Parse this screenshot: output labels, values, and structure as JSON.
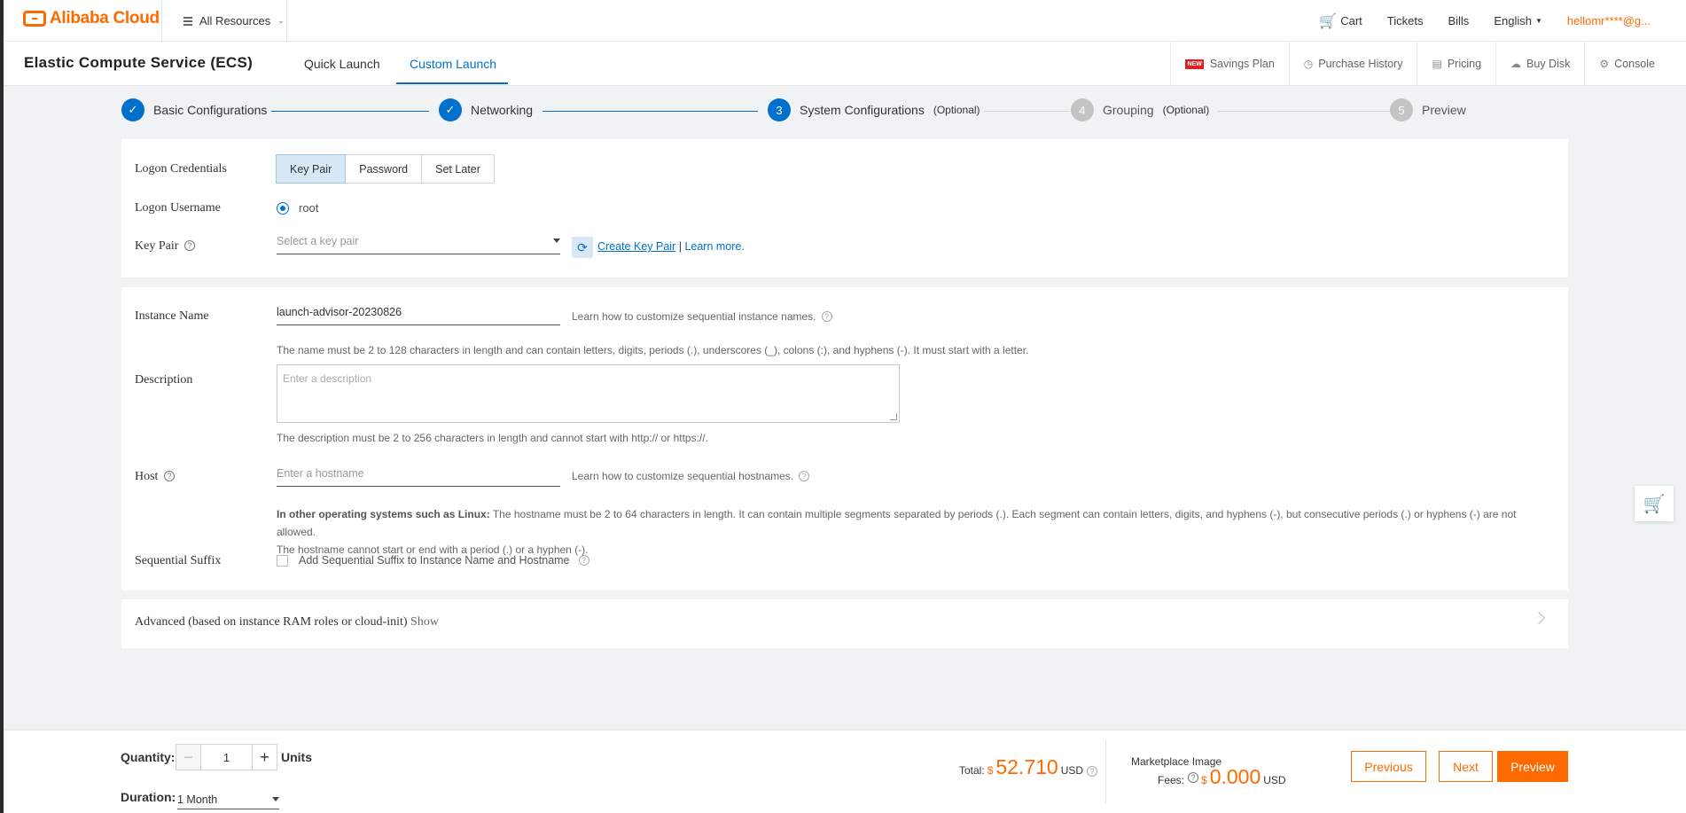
{
  "topbar": {
    "logo": "Alibaba Cloud",
    "all_resources": "All Resources",
    "cart": "Cart",
    "tickets": "Tickets",
    "bills": "Bills",
    "language": "English",
    "user": "hellomr****@g..."
  },
  "subbar": {
    "title": "Elastic Compute Service (ECS)",
    "tabs": [
      "Quick Launch",
      "Custom Launch"
    ],
    "active_tab": "Custom Launch",
    "new_badge": "NEW",
    "links": [
      "Savings Plan",
      "Purchase History",
      "Pricing",
      "Buy Disk",
      "Console"
    ]
  },
  "steps": [
    {
      "num": "",
      "label": "Basic Configurations",
      "optional": "",
      "state": "done"
    },
    {
      "num": "",
      "label": "Networking",
      "optional": "",
      "state": "done"
    },
    {
      "num": "3",
      "label": "System Configurations",
      "optional": "(Optional)",
      "state": "current"
    },
    {
      "num": "4",
      "label": "Grouping",
      "optional": "(Optional)",
      "state": "pending"
    },
    {
      "num": "5",
      "label": "Preview",
      "optional": "",
      "state": "pending"
    }
  ],
  "logon": {
    "credentials_label": "Logon Credentials",
    "options": [
      "Key Pair",
      "Password",
      "Set Later"
    ],
    "selected": "Key Pair",
    "username_label": "Logon Username",
    "username_value": "root",
    "keypair_label": "Key Pair",
    "keypair_placeholder": "Select a key pair",
    "create_key_pair": "Create Key Pair",
    "separator": "|",
    "learn_more": "Learn more."
  },
  "instance": {
    "name_label": "Instance Name",
    "name_value": "launch-advisor-20230826",
    "name_side_hint": "Learn how to customize sequential instance names.",
    "name_hint": "The name must be 2 to 128 characters in length and can contain letters, digits, periods (.), underscores (_), colons (:), and hyphens (-). It must start with a letter.",
    "desc_label": "Description",
    "desc_placeholder": "Enter a description",
    "desc_hint": "The description must be 2 to 256 characters in length and cannot start with http:// or https://.",
    "host_label": "Host",
    "host_placeholder": "Enter a hostname",
    "host_side_hint": "Learn how to customize sequential hostnames.",
    "host_hint_bold": "In other operating systems such as Linux:",
    "host_hint_1": " The hostname must be 2 to 64 characters in length. It can contain multiple segments separated by periods (.). Each segment can contain letters, digits, and hyphens (-), but consecutive periods (.) or hyphens (-) are not allowed.",
    "host_hint_2": "The hostname cannot start or end with a period (.) or a hyphen (-).",
    "suffix_label": "Sequential Suffix",
    "suffix_checkbox": "Add Sequential Suffix to Instance Name and Hostname"
  },
  "advanced": {
    "label": "Advanced (based on instance RAM roles or cloud-init)",
    "toggle": "Show"
  },
  "footer": {
    "quantity_label": "Quantity:",
    "quantity_value": "1",
    "units": "Units",
    "duration_label": "Duration:",
    "duration_value": "1 Month",
    "total_label": "Total:",
    "currency": "$",
    "total_value": "52.710",
    "usd": "USD",
    "marketplace_label": "Marketplace Image",
    "fees_label": "Fees:",
    "fees_value": "0.000",
    "previous": "Previous",
    "next": "Next",
    "preview": "Preview"
  },
  "colors": {
    "brand_orange": "#ff6a00",
    "primary_blue": "#0070cc"
  }
}
